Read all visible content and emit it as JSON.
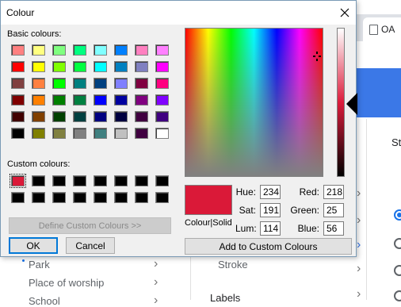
{
  "background": {
    "tab_label": "OA",
    "st_text": "St",
    "left_items": [
      {
        "label": "Park"
      },
      {
        "label": "Place of worship"
      },
      {
        "label": "School"
      }
    ],
    "middle": {
      "stroke": "Stroke",
      "labels": "Labels"
    }
  },
  "dialog": {
    "title": "Colour",
    "basic_label": "Basic colours:",
    "custom_label": "Custom colours:",
    "define_button": "Define Custom Colours >>",
    "ok_button": "OK",
    "cancel_button": "Cancel",
    "add_button": "Add to Custom Colours",
    "preview_label": "Colour|Solid",
    "preview_color": "#da1938",
    "fields": {
      "hue": {
        "label": "Hue:",
        "value": "234"
      },
      "sat": {
        "label": "Sat:",
        "value": "191"
      },
      "lum": {
        "label": "Lum:",
        "value": "114"
      },
      "red": {
        "label": "Red:",
        "value": "218"
      },
      "green": {
        "label": "Green:",
        "value": "25"
      },
      "blue": {
        "label": "Blue:",
        "value": "56"
      }
    },
    "basic_colors": [
      "#ff8080",
      "#ffff80",
      "#80ff80",
      "#00ff80",
      "#80ffff",
      "#0080ff",
      "#ff80c0",
      "#ff80ff",
      "#ff0000",
      "#ffff00",
      "#80ff00",
      "#00ff40",
      "#00ffff",
      "#0080c0",
      "#8080c0",
      "#ff00ff",
      "#804040",
      "#ff8040",
      "#00ff00",
      "#008080",
      "#004080",
      "#8080ff",
      "#800040",
      "#ff0080",
      "#800000",
      "#ff8000",
      "#008000",
      "#008040",
      "#0000ff",
      "#0000a0",
      "#800080",
      "#8000ff",
      "#400000",
      "#804000",
      "#004000",
      "#004040",
      "#000080",
      "#000040",
      "#400040",
      "#400080",
      "#000000",
      "#808000",
      "#808040",
      "#808080",
      "#408080",
      "#c0c0c0",
      "#400040",
      "#ffffff"
    ],
    "custom_colors": [
      "#da1938",
      "#000000",
      "#000000",
      "#000000",
      "#000000",
      "#000000",
      "#000000",
      "#000000",
      "#000000",
      "#000000",
      "#000000",
      "#000000",
      "#000000",
      "#000000",
      "#000000",
      "#000000"
    ]
  }
}
